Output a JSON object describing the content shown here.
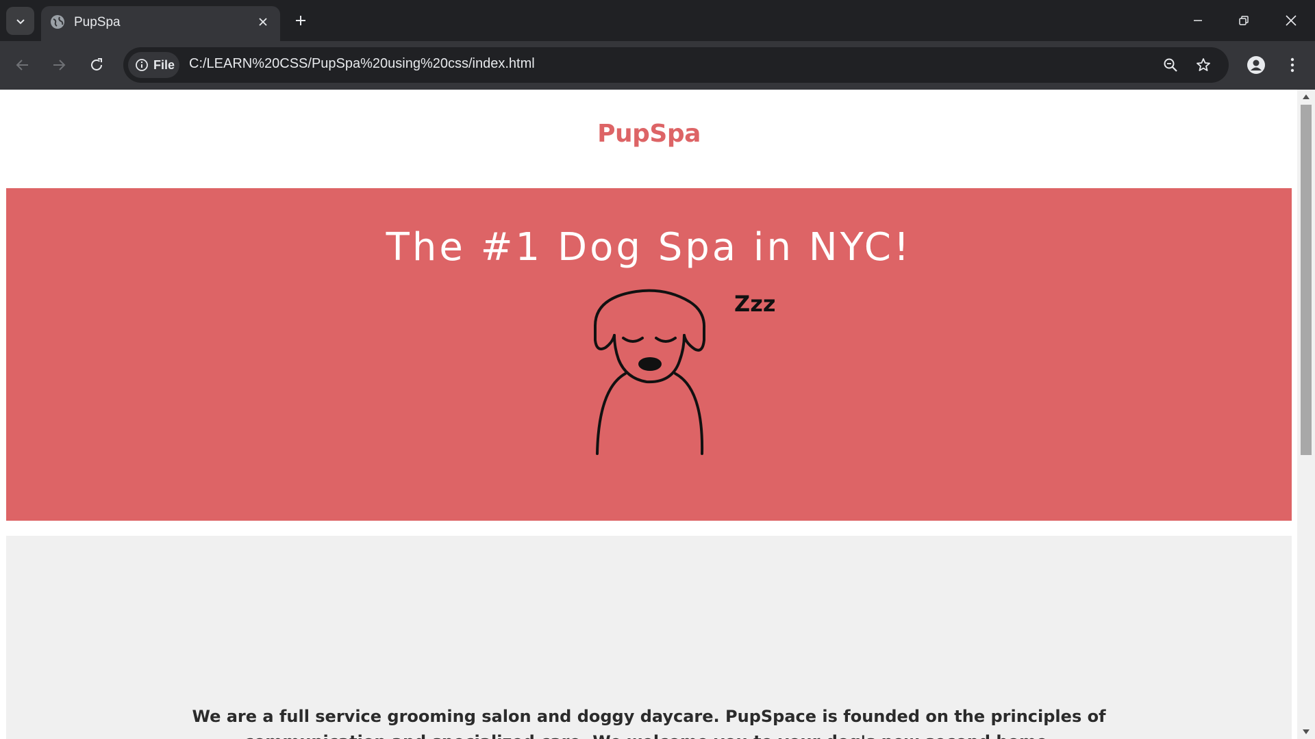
{
  "browser": {
    "tab": {
      "title": "PupSpa",
      "favicon": "globe-icon",
      "close": "close-icon"
    },
    "new_tab": "plus-icon",
    "tab_search": "chevron-down-icon",
    "window_controls": [
      "minimize-icon",
      "restore-icon",
      "close-icon"
    ],
    "toolbar": {
      "back": "arrow-left-icon",
      "forward": "arrow-right-icon",
      "reload": "reload-icon",
      "site_chip_label": "File",
      "url": "C:/LEARN%20CSS/PupSpa%20using%20css/index.html",
      "zoom": "zoom-icon",
      "bookmark": "star-icon",
      "profile": "person-icon",
      "menu": "kebab-menu-icon"
    }
  },
  "page": {
    "brand": "PupSpa",
    "hero": {
      "title": "The #1 Dog Spa in NYC!",
      "art": "sleeping-dog-illustration",
      "zzz": "Zzz"
    },
    "about": {
      "text": "We are a full service grooming salon and doggy daycare. PupSpace is founded on the principles of communication and specialized care. We welcome you to your dog's new second home."
    }
  },
  "colors": {
    "brand": "#dd6466",
    "hero_bg": "#dd6466",
    "about_bg": "#f0f0f0",
    "chrome_dark": "#202124",
    "chrome_toolbar": "#35363a"
  }
}
